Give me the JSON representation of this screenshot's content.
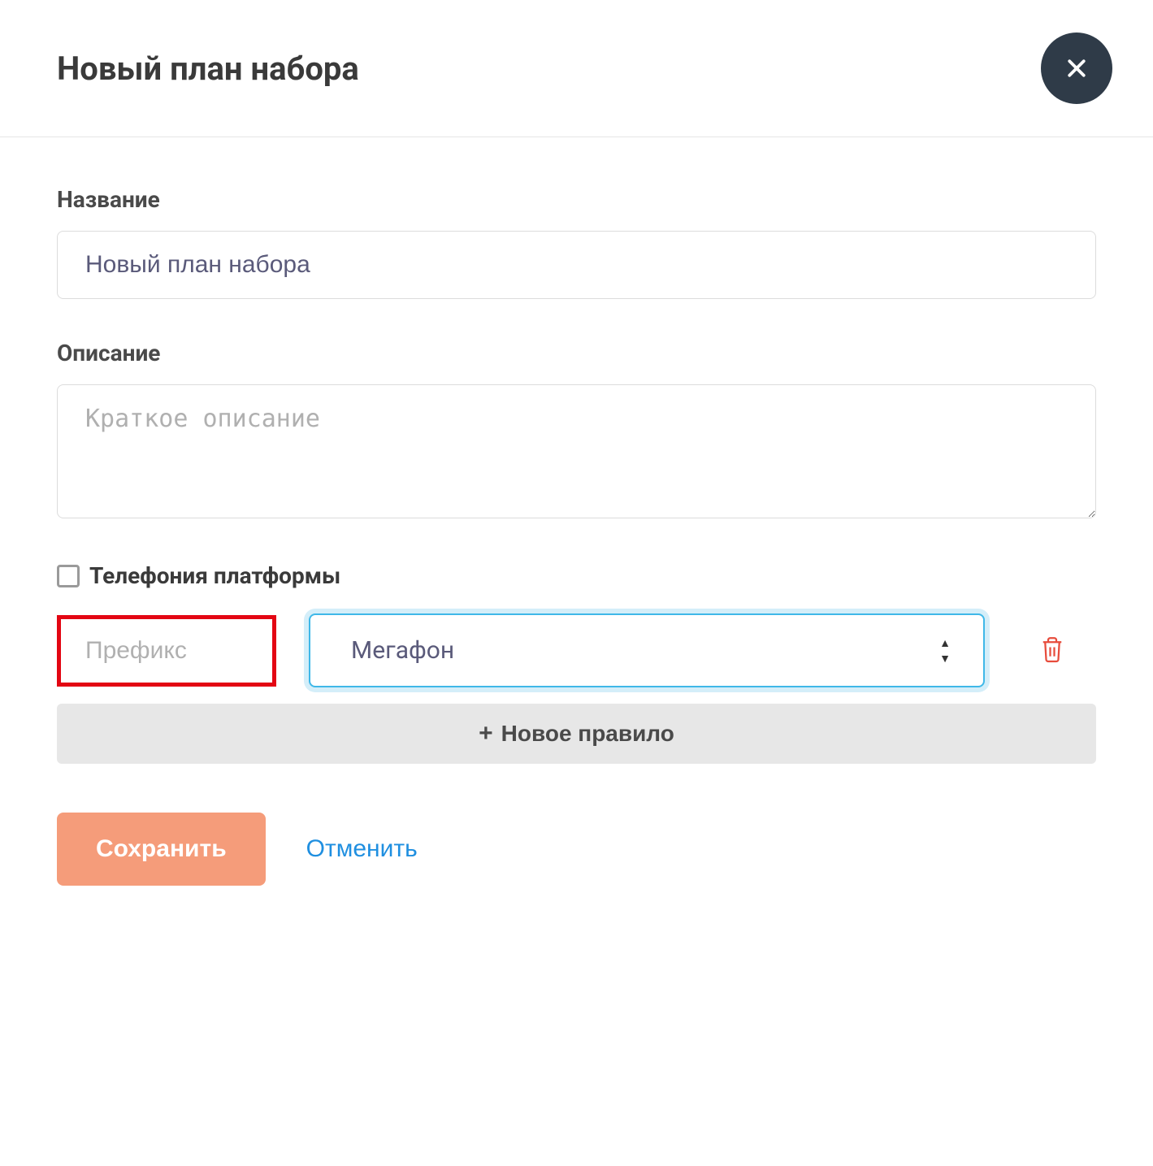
{
  "header": {
    "title": "Новый план набора"
  },
  "form": {
    "name_label": "Название",
    "name_value": "Новый план набора",
    "description_label": "Описание",
    "description_placeholder": "Краткое описание",
    "description_value": "",
    "telephony_checkbox_label": "Телефония платформы",
    "telephony_checked": false
  },
  "rule": {
    "prefix_placeholder": "Префикс",
    "prefix_value": "",
    "operator_selected": "Мегафон"
  },
  "actions": {
    "new_rule_label": "Новое правило",
    "save_label": "Сохранить",
    "cancel_label": "Отменить"
  }
}
